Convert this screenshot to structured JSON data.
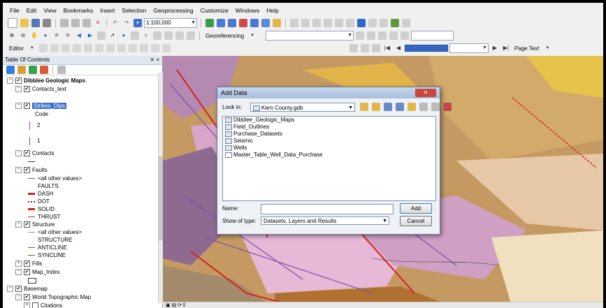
{
  "menu": [
    "File",
    "Edit",
    "View",
    "Bookmarks",
    "Insert",
    "Selection",
    "Geoprocessing",
    "Customize",
    "Windows",
    "Help"
  ],
  "toolbar": {
    "scale": "1:100,000",
    "georeferencing": "Georeferencing",
    "editor": "Editor",
    "page_text": "Page Text"
  },
  "toc": {
    "title": "Table Of Contents",
    "pin": "⨯ ×",
    "items": [
      {
        "label": "Dibblee Geologic Maps"
      },
      {
        "label": "Contacts_text"
      },
      {
        "label": "Strikes_Dips"
      },
      {
        "label": "Code"
      },
      {
        "label": "2"
      },
      {
        "label": "1"
      },
      {
        "label": "Contacts"
      },
      {
        "label": "Faults"
      },
      {
        "label": "<all other values>"
      },
      {
        "label": "FAULTS"
      },
      {
        "label": "DASH"
      },
      {
        "label": "DOT"
      },
      {
        "label": "SOLID"
      },
      {
        "label": "THRUST"
      },
      {
        "label": "Structure"
      },
      {
        "label": "<all other values>"
      },
      {
        "label": "STRUCTURE"
      },
      {
        "label": "ANTICLINE"
      },
      {
        "label": "SYNCLINE"
      },
      {
        "label": "Fills"
      },
      {
        "label": "Map_Index"
      },
      {
        "label": "Basemap"
      },
      {
        "label": "World Topographic Map"
      },
      {
        "label": "Citations"
      }
    ]
  },
  "dialog": {
    "title": "Add Data",
    "look_in_label": "Look in:",
    "look_in_value": "Kern County.gdb",
    "files": [
      "Dibblee_Geologic_Maps",
      "Field_Outlines",
      "Purchase_Datasets",
      "Seismic",
      "Wells",
      "Master_Table_Well_Data_Purchase"
    ],
    "name_label": "Name:",
    "name_value": "",
    "type_label": "Show of type:",
    "type_value": "Datasets, Layers and Results",
    "add_label": "Add",
    "cancel_label": "Cancel"
  },
  "colors": {
    "accent": "#3a71c7",
    "dash": "#d42020",
    "dot": "#b02020",
    "solid": "#d42020",
    "thrust": "#c83030"
  }
}
